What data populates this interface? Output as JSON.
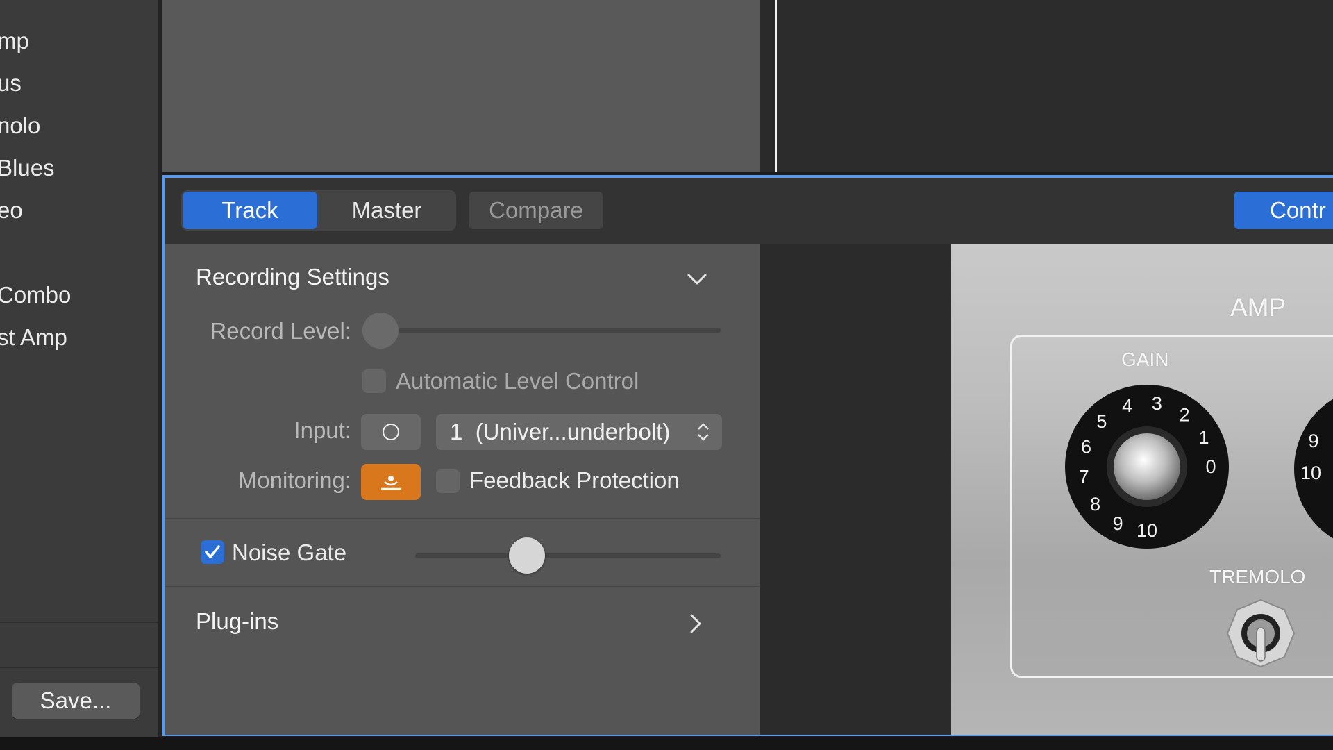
{
  "library": {
    "items": [
      "mp",
      "us",
      "nolo",
      "Blues",
      "eo",
      "Combo",
      "st Amp"
    ],
    "save_label": "Save..."
  },
  "tabs": {
    "track": "Track",
    "master": "Master",
    "compare": "Compare",
    "controls": "Contr"
  },
  "recording_settings": {
    "title": "Recording Settings",
    "record_level_label": "Record Level:",
    "record_level_value": 0.0,
    "automatic_level_control_label": "Automatic Level Control",
    "automatic_level_control_checked": false,
    "input_label": "Input:",
    "input_value": "1  (Univer...underbolt)",
    "monitoring_label": "Monitoring:",
    "monitoring_on": true,
    "feedback_protection_label": "Feedback Protection",
    "feedback_protection_checked": false
  },
  "noise_gate": {
    "label": "Noise Gate",
    "checked": true,
    "value": 0.37
  },
  "plugins": {
    "title": "Plug-ins"
  },
  "amp": {
    "title": "AMP",
    "gain_label": "GAIN",
    "gain_scale": [
      "0",
      "1",
      "2",
      "3",
      "4",
      "5",
      "6",
      "7",
      "8",
      "9",
      "10"
    ],
    "tremolo_label": "TREMOLO",
    "second_knob_partial": [
      "9",
      "10"
    ]
  },
  "colors": {
    "accent_blue": "#2b6fd6",
    "monitoring_orange": "#d9771c",
    "panel_border": "#5b9ae8"
  }
}
